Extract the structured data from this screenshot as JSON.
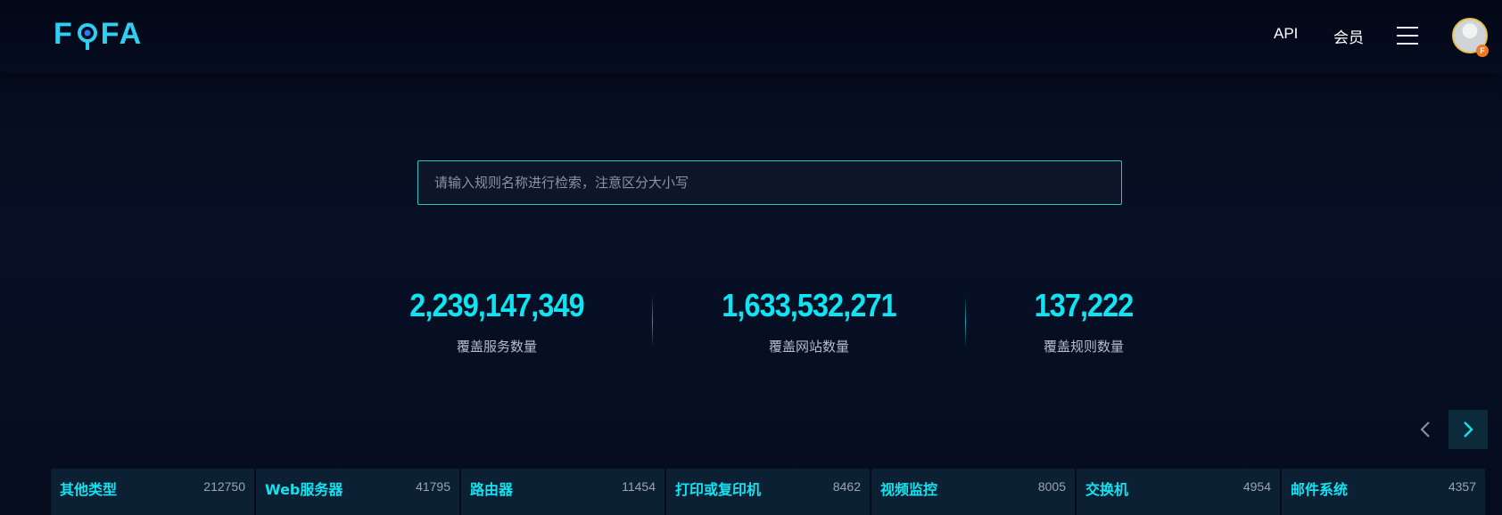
{
  "header": {
    "logo": "FOFA",
    "nav": {
      "api_label": "API",
      "member_label": "会员"
    },
    "avatar_badge": "F"
  },
  "search": {
    "placeholder": "请输入规则名称进行检索，注意区分大小写",
    "value": ""
  },
  "stats": [
    {
      "value": "2,239,147,349",
      "label": "覆盖服务数量"
    },
    {
      "value": "1,633,532,271",
      "label": "覆盖网站数量"
    },
    {
      "value": "137,222",
      "label": "覆盖规则数量"
    }
  ],
  "categories": [
    {
      "name": "其他类型",
      "count": "212750"
    },
    {
      "name": "Web服务器",
      "count": "41795"
    },
    {
      "name": "路由器",
      "count": "11454"
    },
    {
      "name": "打印或复印机",
      "count": "8462"
    },
    {
      "name": "视频监控",
      "count": "8005"
    },
    {
      "name": "交换机",
      "count": "4954"
    },
    {
      "name": "邮件系统",
      "count": "4357"
    }
  ],
  "colors": {
    "accent": "#10e4f2",
    "background": "#040b1d",
    "search_border": "#2bc3c9",
    "category_bg": "#0b2033"
  }
}
